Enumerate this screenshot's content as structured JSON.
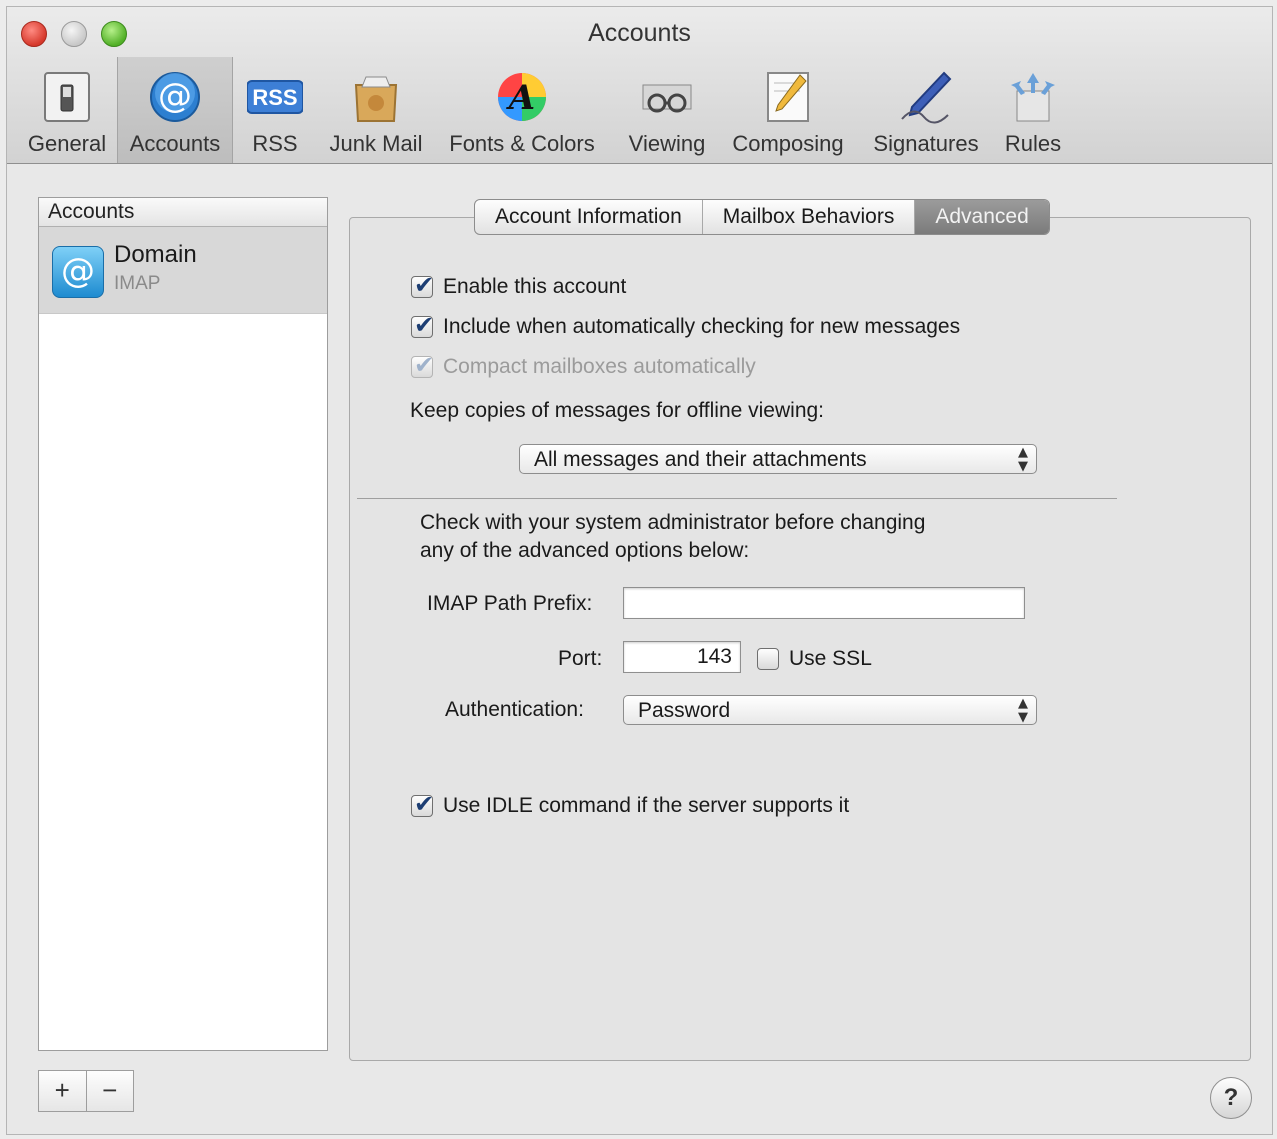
{
  "window": {
    "title": "Accounts"
  },
  "toolbar": {
    "items": [
      {
        "label": "General",
        "icon": "general-switch-icon"
      },
      {
        "label": "Accounts",
        "icon": "at-sign-icon",
        "selected": true
      },
      {
        "label": "RSS",
        "icon": "rss-icon"
      },
      {
        "label": "Junk Mail",
        "icon": "junk-mail-icon"
      },
      {
        "label": "Fonts & Colors",
        "icon": "fonts-colors-icon"
      },
      {
        "label": "Viewing",
        "icon": "viewing-glasses-icon"
      },
      {
        "label": "Composing",
        "icon": "composing-pencil-icon"
      },
      {
        "label": "Signatures",
        "icon": "signature-pen-icon"
      },
      {
        "label": "Rules",
        "icon": "rules-arrows-icon"
      }
    ]
  },
  "sidebar": {
    "header": "Accounts",
    "accounts": [
      {
        "name": "Domain",
        "type": "IMAP",
        "icon": "at-sign-icon"
      }
    ],
    "add_label": "+",
    "remove_label": "−"
  },
  "tabs": {
    "items": [
      "Account Information",
      "Mailbox Behaviors",
      "Advanced"
    ],
    "active": "Advanced"
  },
  "advanced": {
    "enable_account": {
      "label": "Enable this account",
      "checked": true
    },
    "include_auto_check": {
      "label": "Include when automatically checking for new messages",
      "checked": true
    },
    "compact_mailboxes": {
      "label": "Compact mailboxes automatically",
      "checked": true,
      "disabled": true
    },
    "keep_copies_label": "Keep copies of messages for offline viewing:",
    "keep_copies_value": "All messages and their attachments",
    "warning_line1": "Check with your system administrator before changing",
    "warning_line2": "any of the advanced options below:",
    "imap_prefix_label": "IMAP Path Prefix:",
    "imap_prefix_value": "",
    "port_label": "Port:",
    "port_value": "143",
    "use_ssl": {
      "label": "Use SSL",
      "checked": false
    },
    "auth_label": "Authentication:",
    "auth_value": "Password",
    "use_idle": {
      "label": "Use IDLE command if the server supports it",
      "checked": true
    }
  },
  "help": {
    "label": "?"
  },
  "colors": {
    "window_bg": "#e8e8e8",
    "selected_row": "#d8d8d8",
    "active_tab": "#8a8a8a",
    "close_button": "#d6392c",
    "zoom_button": "#52b027"
  }
}
